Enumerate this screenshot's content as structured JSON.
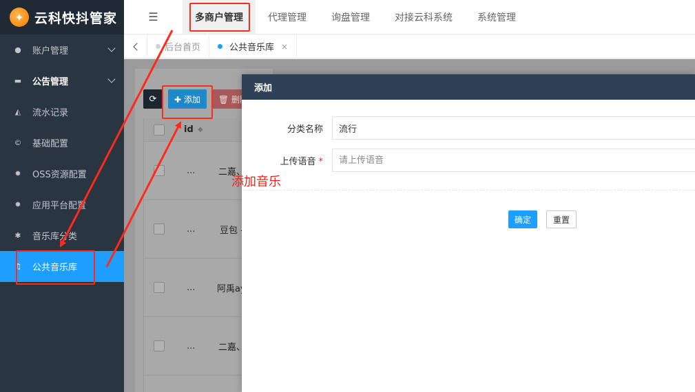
{
  "brand": {
    "logo_glyph": "✦",
    "name": "云科快抖管家"
  },
  "sidebar": {
    "items": [
      {
        "label": "账户管理",
        "icon": "user-icon",
        "glyph": "●",
        "has_caret": true
      },
      {
        "label": "公告管理",
        "icon": "card-icon",
        "glyph": "▬",
        "has_caret": true
      },
      {
        "label": "流水记录",
        "icon": "area-chart-icon",
        "glyph": "◭",
        "has_caret": false
      },
      {
        "label": "基础配置",
        "icon": "copyright-icon",
        "glyph": "©",
        "has_caret": false
      },
      {
        "label": "OSS资源配置",
        "icon": "gear-icon",
        "glyph": "✹",
        "has_caret": false
      },
      {
        "label": "应用平台配置",
        "icon": "gear-icon",
        "glyph": "✹",
        "has_caret": false
      },
      {
        "label": "音乐库分类",
        "icon": "asterisk-icon",
        "glyph": "✱",
        "has_caret": false
      },
      {
        "label": "公共音乐库",
        "icon": "music-icon",
        "glyph": "♫",
        "has_caret": false
      }
    ]
  },
  "topbar": {
    "menu_glyph": "☰",
    "nav": [
      "多商户管理",
      "代理管理",
      "询盘管理",
      "对接云科系统",
      "系统管理"
    ]
  },
  "tabs": [
    {
      "label": "后台首页",
      "closable": false
    },
    {
      "label": "公共音乐库",
      "closable": true,
      "close_glyph": "×"
    }
  ],
  "toolbar": {
    "refresh_glyph": "⟳",
    "add_label": "✚ 添加",
    "delete_label": "🗑 删除"
  },
  "table": {
    "id_header": "id",
    "sort_glyph": "◆",
    "ellipsis": "...",
    "rows": [
      "二嘉、",
      "豆包 -",
      "阿禹ay",
      "二嘉、"
    ]
  },
  "modal": {
    "title": "添加",
    "category_label": "分类名称",
    "category_value": "流行",
    "upload_label": "上传语音",
    "required_mark": "*",
    "upload_placeholder": "请上传语音",
    "confirm_label": "确定",
    "reset_label": "重置"
  },
  "annotation": {
    "text": "添加音乐",
    "color": "#e8251a"
  },
  "colors": {
    "sidebar_bg": "#2a3542",
    "active": "#1e9fff",
    "modal_header": "#2f4155",
    "highlight": "#ff2a1a"
  }
}
